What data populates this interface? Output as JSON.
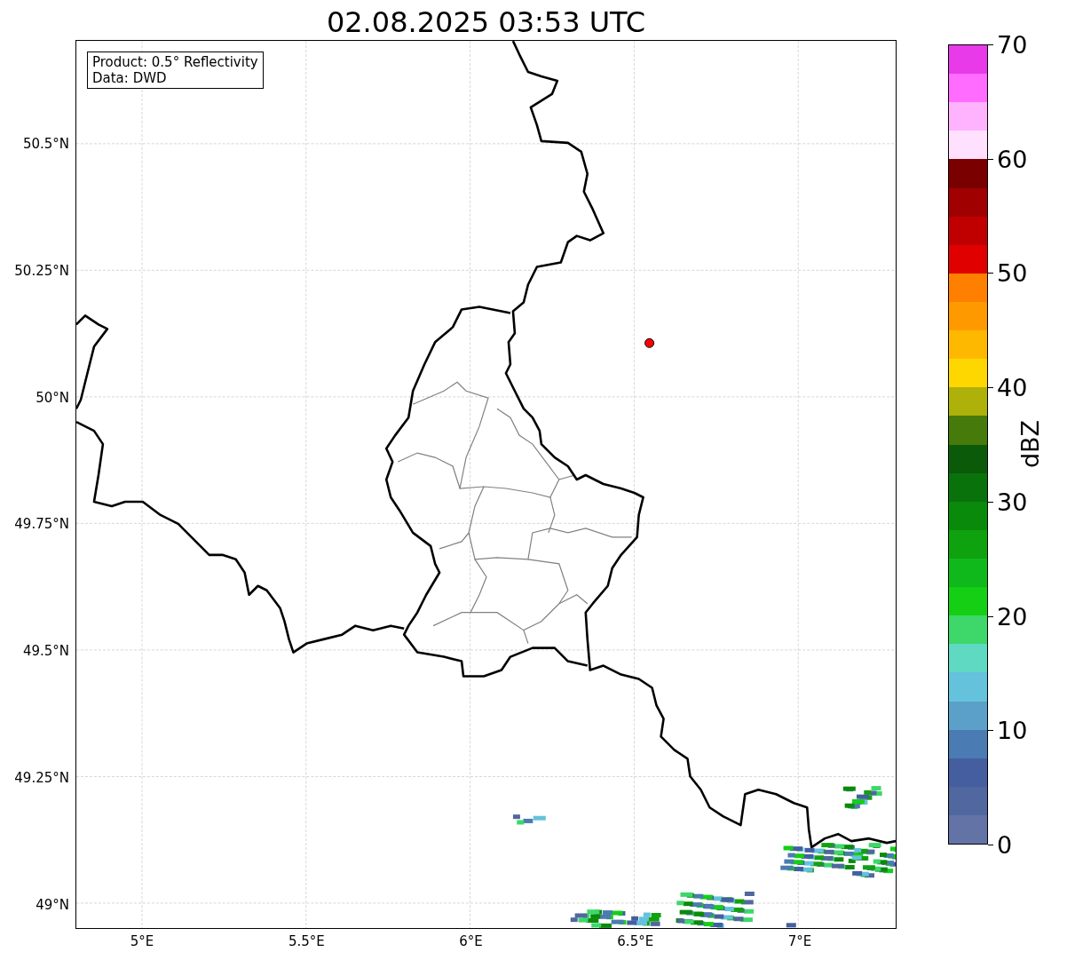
{
  "title": "02.08.2025 03:53 UTC",
  "info_box": {
    "lines": [
      "Product: 0.5° Reflectivity",
      "Data: DWD"
    ]
  },
  "map": {
    "xticks": [
      "5°E",
      "5.5°E",
      "6°E",
      "6.5°E",
      "7°E"
    ],
    "yticks": [
      "50.5°N",
      "50.25°N",
      "50°N",
      "49.75°N",
      "49.5°N",
      "49.25°N",
      "49°N"
    ]
  },
  "colorbar": {
    "label": "dBZ",
    "ticks": [
      "70",
      "60",
      "50",
      "40",
      "30",
      "20",
      "10",
      "0"
    ],
    "segments": [
      {
        "color": "#e93aea"
      },
      {
        "color": "#ff6cff"
      },
      {
        "color": "#ffb3ff"
      },
      {
        "color": "#ffe0ff"
      },
      {
        "color": "#7a0000"
      },
      {
        "color": "#a00000"
      },
      {
        "color": "#c00000"
      },
      {
        "color": "#e00000"
      },
      {
        "color": "#ff7f00"
      },
      {
        "color": "#ff9900"
      },
      {
        "color": "#ffb800"
      },
      {
        "color": "#ffd700"
      },
      {
        "color": "#aeb10a"
      },
      {
        "color": "#467a0a"
      },
      {
        "color": "#0a5a0a"
      },
      {
        "color": "#0a720a"
      },
      {
        "color": "#0a8a0a"
      },
      {
        "color": "#0fa20f"
      },
      {
        "color": "#10b91b"
      },
      {
        "color": "#14cf14"
      },
      {
        "color": "#3dd76a"
      },
      {
        "color": "#60d9c3"
      },
      {
        "color": "#64c2dc"
      },
      {
        "color": "#5aa0c8"
      },
      {
        "color": "#4a7bb2"
      },
      {
        "color": "#445ea0"
      },
      {
        "color": "#50679f"
      },
      {
        "color": "#6473a6"
      }
    ]
  }
}
